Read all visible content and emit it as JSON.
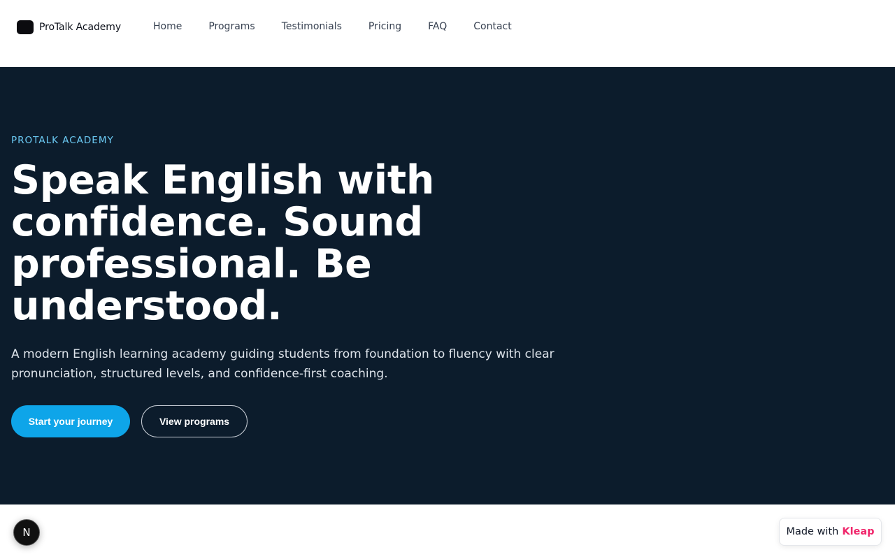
{
  "nav": {
    "brand": "ProTalk Academy",
    "links": [
      "Home",
      "Programs",
      "Testimonials",
      "Pricing",
      "FAQ",
      "Contact"
    ]
  },
  "hero": {
    "eyebrow": "PROTALK ACADEMY",
    "headline": "Speak English with confidence. Sound professional. Be understood.",
    "subtext": "A modern English learning academy guiding students from foundation to fluency with clear pronunciation, structured levels, and confidence-first coaching.",
    "primary_cta": "Start your journey",
    "secondary_cta": "View programs"
  },
  "floating": {
    "badge_letter": "N",
    "made_with_prefix": "Made with",
    "made_with_brand": "Kleap"
  },
  "colors": {
    "hero_bg": "#0c1c2c",
    "accent": "#0ea5e9",
    "eyebrow": "#6ccbf5",
    "kleap_brand": "#f0266b"
  }
}
